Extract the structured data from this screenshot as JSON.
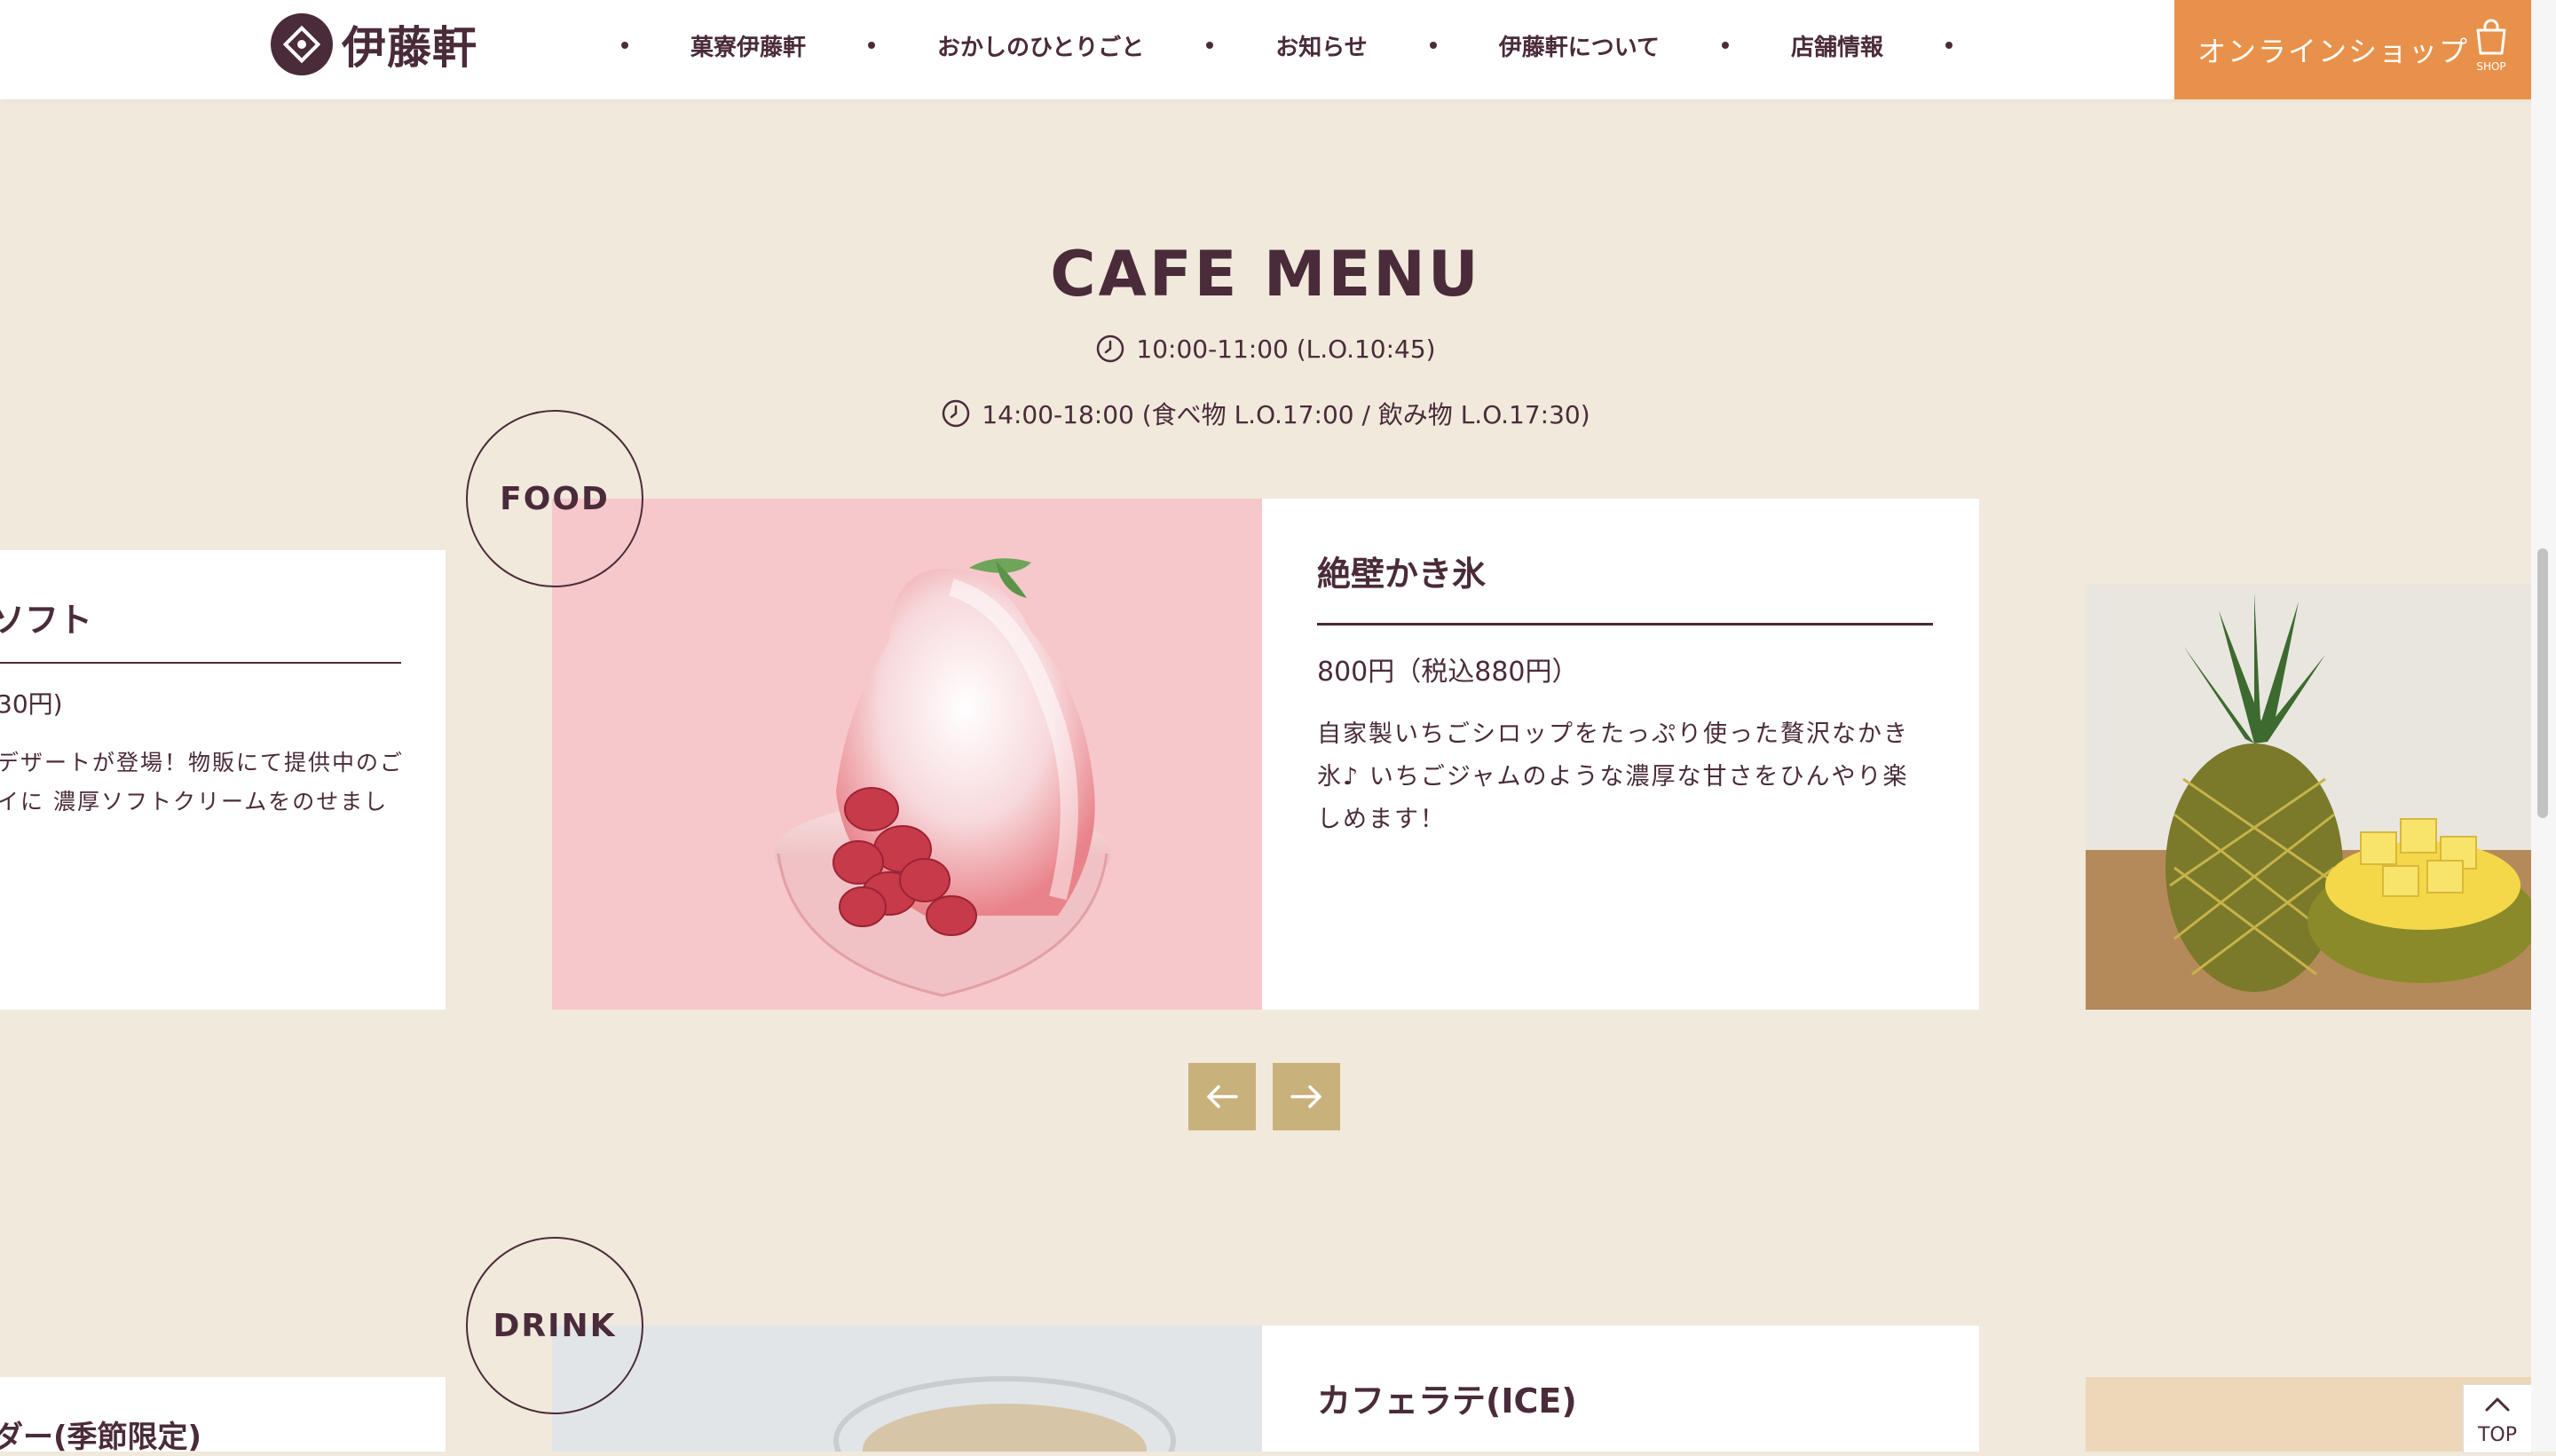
{
  "brand": {
    "name": "伊藤軒"
  },
  "nav": {
    "items": [
      {
        "label": "菓寮伊藤軒"
      },
      {
        "label": "おかしのひとりごと"
      },
      {
        "label": "お知らせ"
      },
      {
        "label": "伊藤軒について"
      },
      {
        "label": "店舗情報"
      }
    ],
    "shop_label": "オンラインショップ",
    "shop_icon_text": "SHOP"
  },
  "section": {
    "title": "CAFE MENU",
    "hours": [
      "10:00-11:00 (L.O.10:45)",
      "14:00-18:00 (食べ物 L.O.17:00 / 飲み物 L.O.17:30)"
    ]
  },
  "food": {
    "label": "FOOD",
    "prev_card": {
      "title_fragment": "ソフト",
      "price_fragment": "30円)",
      "desc_line1": "デザートが登場！物販にて提供中のご",
      "desc_line2": "イに 濃厚ソフトクリームをのせまし"
    },
    "card": {
      "title": "絶壁かき氷",
      "price": "800円（税込880円）",
      "description": "自家製いちごシロップをたっぷり使った贅沢なかき氷♪ いちごジャムのような濃厚な甘さをひんやり楽しめます！"
    }
  },
  "drink": {
    "label": "DRINK",
    "prev_card": {
      "title_fragment": "ダー(季節限定)"
    },
    "card": {
      "title": "カフェラテ(ICE)"
    }
  },
  "top_button": {
    "label": "TOP"
  },
  "colors": {
    "accent": "#e8914a",
    "brown": "#4a2b3a",
    "beige": "#f0e9dc",
    "gold": "#c9b17c"
  }
}
